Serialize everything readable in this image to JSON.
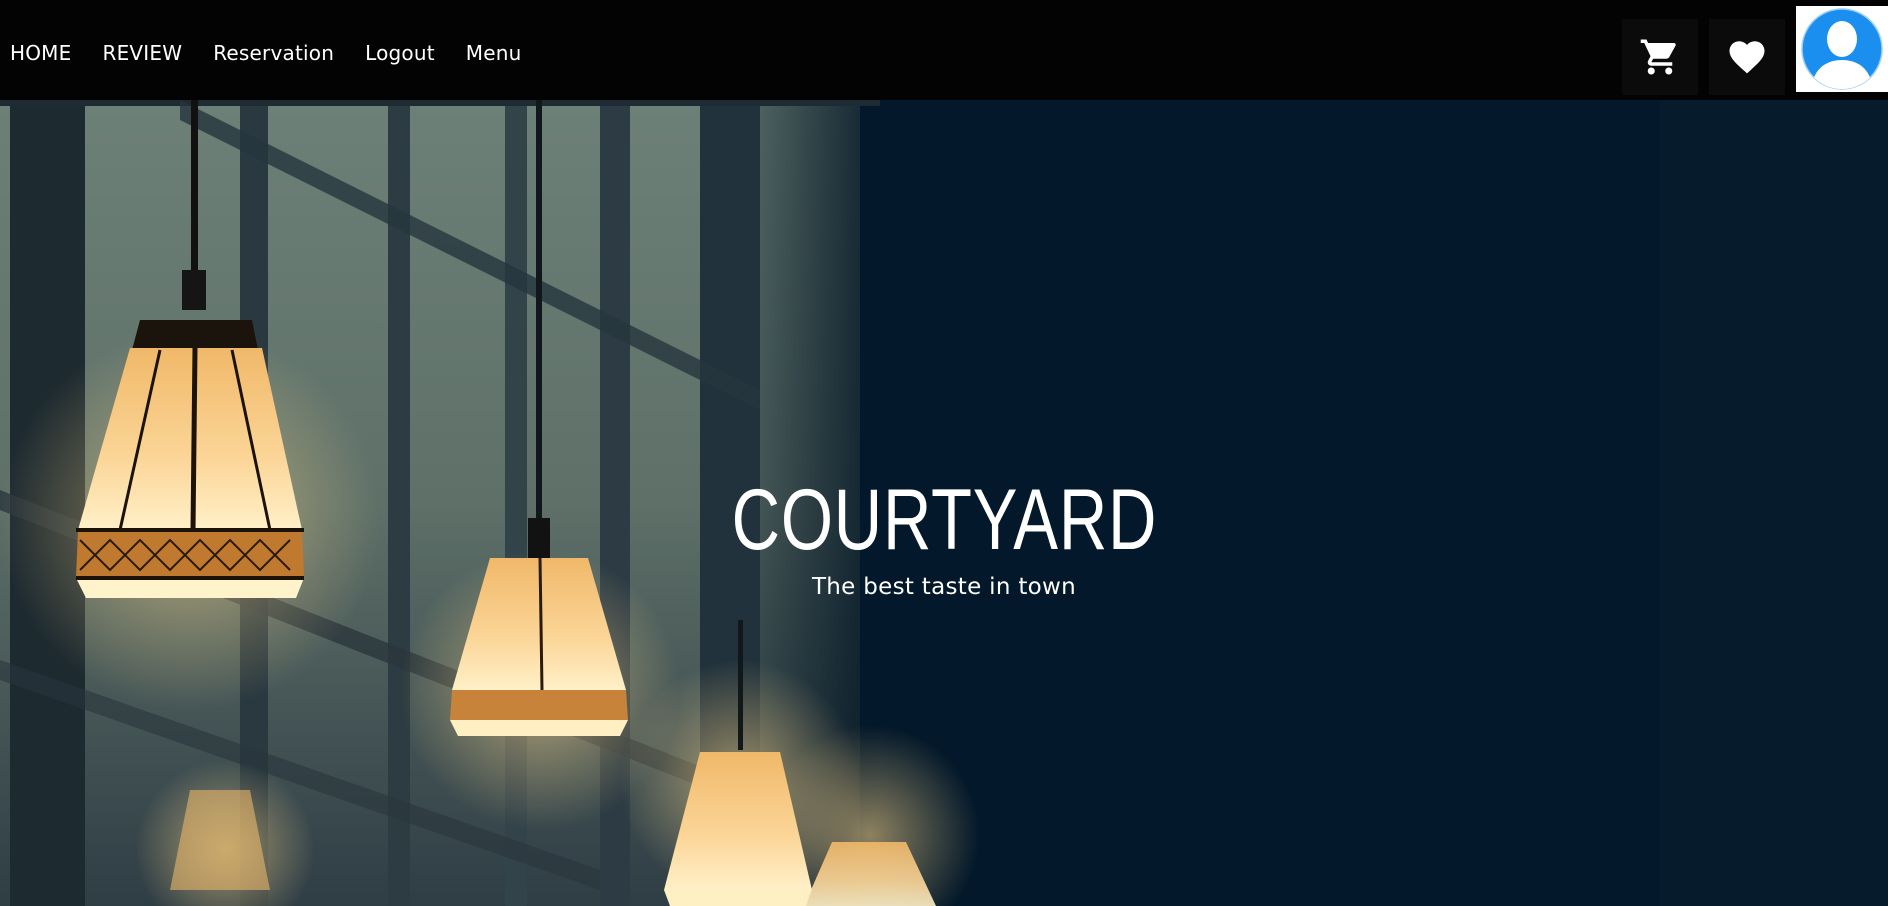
{
  "nav": {
    "links": [
      {
        "label": "HOME"
      },
      {
        "label": "REVIEW"
      },
      {
        "label": "Reservation"
      },
      {
        "label": "Logout"
      },
      {
        "label": "Menu"
      }
    ],
    "icons": {
      "cart": "shopping-cart-icon",
      "favorites": "heart-icon",
      "profile": "user-avatar-icon"
    }
  },
  "hero": {
    "title": "COURTYARD",
    "subtitle": "The best taste in town"
  },
  "colors": {
    "navbar": "#030303",
    "hero_dark": "#041625",
    "lamp_glow": "#f5c878",
    "avatar_blue": "#1a8ff0",
    "text": "#ffffff"
  }
}
